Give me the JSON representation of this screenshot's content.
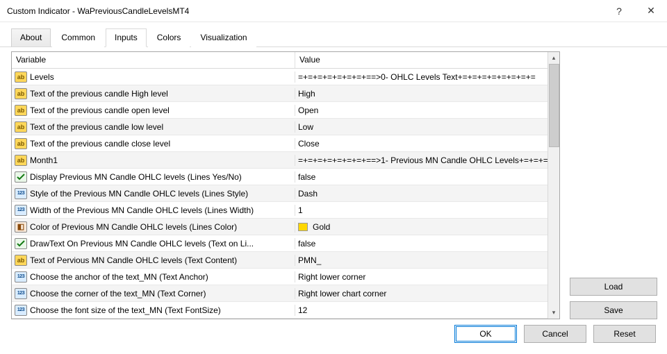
{
  "window": {
    "title": "Custom Indicator - WaPreviousCandleLevelsMT4"
  },
  "tabs": {
    "items": [
      "About",
      "Common",
      "Inputs",
      "Colors",
      "Visualization"
    ],
    "active": 2
  },
  "grid": {
    "header": {
      "variable": "Variable",
      "value": "Value"
    },
    "rows": [
      {
        "icon": "ab",
        "variable": "Levels",
        "value": "=+=+=+=+=+=+=+==>0- OHLC Levels Text+=+=+=+=+=+=+=+="
      },
      {
        "icon": "ab",
        "variable": "Text of the previous candle High level",
        "value": "High"
      },
      {
        "icon": "ab",
        "variable": "Text of the previous candle open level",
        "value": "Open"
      },
      {
        "icon": "ab",
        "variable": "Text of the previous candle low level",
        "value": "Low"
      },
      {
        "icon": "ab",
        "variable": "Text of the previous candle close level",
        "value": "Close"
      },
      {
        "icon": "ab",
        "variable": "Month1",
        "value": "=+=+=+=+=+=+=+==>1- Previous MN Candle OHLC Levels+=+=+=+..."
      },
      {
        "icon": "tf",
        "variable": "Display Previous MN Candle OHLC levels (Lines Yes/No)",
        "value": "false"
      },
      {
        "icon": "num",
        "variable": "Style of the Previous MN Candle OHLC levels (Lines Style)",
        "value": "Dash"
      },
      {
        "icon": "num",
        "variable": "Width of the Previous MN Candle OHLC levels (Lines Width)",
        "value": "1"
      },
      {
        "icon": "color",
        "variable": "Color of Previous MN Candle OHLC levels (Lines Color)",
        "value": "Gold",
        "swatch": "#ffd700"
      },
      {
        "icon": "tf",
        "variable": "DrawText On Previous MN Candle OHLC levels (Text on Li...",
        "value": "false"
      },
      {
        "icon": "ab",
        "variable": "Text of Pervious MN Candle OHLC levels (Text Content)",
        "value": "PMN_"
      },
      {
        "icon": "num",
        "variable": "Choose the anchor of the text_MN (Text Anchor)",
        "value": "Right lower corner"
      },
      {
        "icon": "num",
        "variable": "Choose the corner of the text_MN (Text Corner)",
        "value": "Right lower chart corner"
      },
      {
        "icon": "num",
        "variable": "Choose the font size of the text_MN (Text FontSize)",
        "value": "12"
      }
    ]
  },
  "buttons": {
    "load": "Load",
    "save": "Save",
    "ok": "OK",
    "cancel": "Cancel",
    "reset": "Reset"
  }
}
